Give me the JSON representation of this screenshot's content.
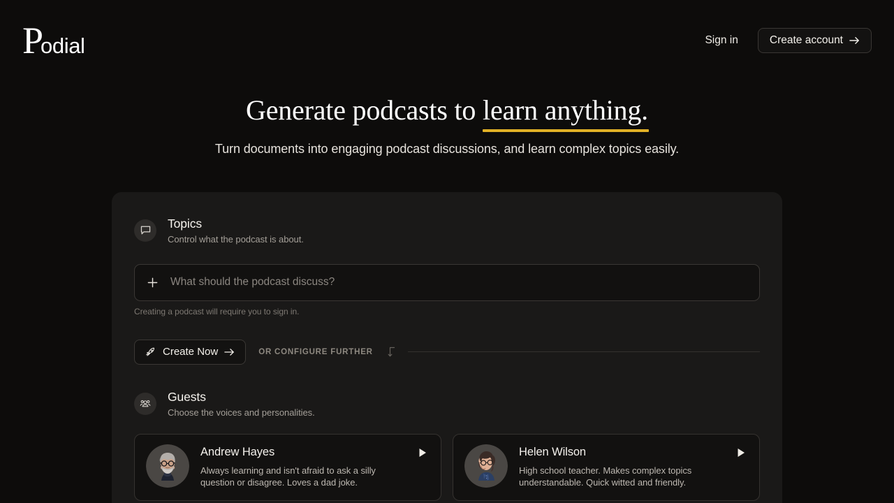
{
  "brand": {
    "logo_first": "P",
    "logo_rest": "odial"
  },
  "header": {
    "sign_in_label": "Sign in",
    "create_account_label": "Create account",
    "arrow_icon": "arrow-right-icon"
  },
  "hero": {
    "title_lead": "Generate podcasts to ",
    "title_highlight": "learn anything.",
    "subtitle": "Turn documents into engaging podcast discussions, and learn complex topics easily.",
    "underline_color": "#e1b126"
  },
  "topics": {
    "icon": "speech-bubble-icon",
    "title": "Topics",
    "description": "Control what the podcast is about.",
    "input_placeholder": "What should the podcast discuss?",
    "input_value": "",
    "add_icon": "plus-icon",
    "note": "Creating a podcast will require you to sign in."
  },
  "actions": {
    "create_now_label": "Create Now",
    "rocket_icon": "rocket-icon",
    "arrow_icon": "arrow-right-icon",
    "or_label": "OR CONFIGURE FURTHER",
    "corner_icon": "corner-down-arrow-icon"
  },
  "guests": {
    "icon": "users-group-icon",
    "title": "Guests",
    "description": "Choose the voices and personalities.",
    "cards": [
      {
        "name": "Andrew Hayes",
        "description": "Always learning and isn't afraid to ask a silly question or disagree. Loves a dad joke.",
        "avatar": "avatar-andrew",
        "play_icon": "play-icon"
      },
      {
        "name": "Helen Wilson",
        "description": "High school teacher. Makes complex topics understandable. Quick witted and friendly.",
        "avatar": "avatar-helen",
        "play_icon": "play-icon"
      }
    ]
  }
}
